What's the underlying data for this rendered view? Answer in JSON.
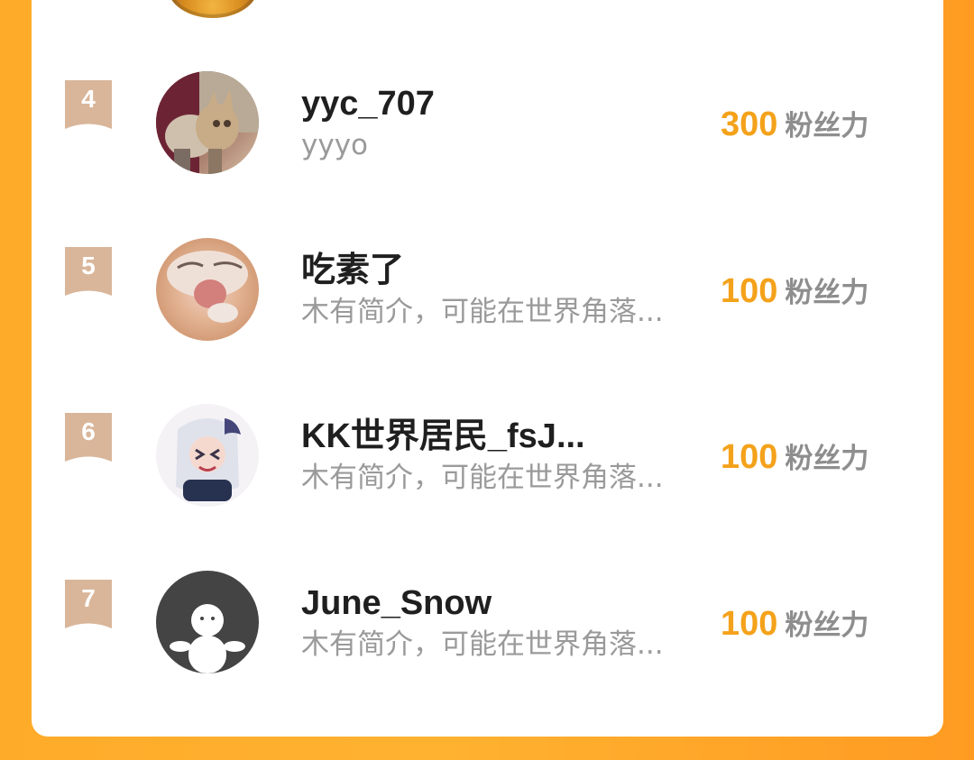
{
  "ranking": {
    "rows": [
      {
        "rank": "4",
        "name": "yyc_707",
        "bio": "yyyo",
        "score": "300",
        "score_unit": "粉丝力",
        "avatar_icon": "cat-photo-avatar"
      },
      {
        "rank": "5",
        "name": "吃素了",
        "bio": "木有简介，可能在世界角落...",
        "score": "100",
        "score_unit": "粉丝力",
        "avatar_icon": "cat-closeup-avatar"
      },
      {
        "rank": "6",
        "name": "KK世界居民_fsJ...",
        "bio": "木有简介，可能在世界角落...",
        "score": "100",
        "score_unit": "粉丝力",
        "avatar_icon": "anime-girl-avatar"
      },
      {
        "rank": "7",
        "name": "June_Snow",
        "bio": "木有简介，可能在世界角落...",
        "score": "100",
        "score_unit": "粉丝力",
        "avatar_icon": "default-user-avatar"
      }
    ]
  },
  "colors": {
    "background_orange": "#ffab2a",
    "score_orange": "#f4a21b",
    "rank_badge": "#d9b69a",
    "name_text": "#1f1f1f",
    "bio_text": "#9a9a9a",
    "unit_text": "#8e8e8e"
  }
}
